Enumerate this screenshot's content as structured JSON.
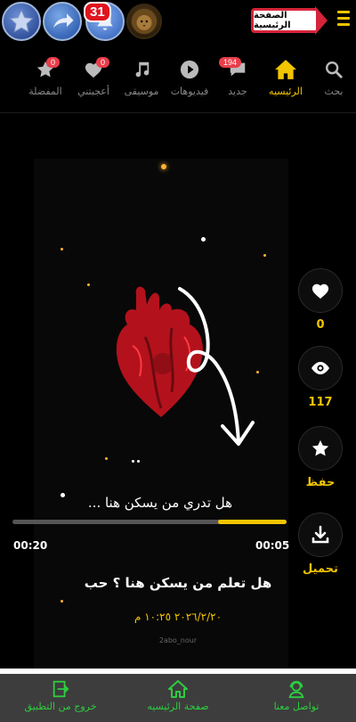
{
  "topbar": {
    "notification_count": "31",
    "home_sign_label": "الصفحة الرئيسية"
  },
  "nav": {
    "items": [
      {
        "label": "بحث",
        "icon": "search-icon"
      },
      {
        "label": "الرئيسيه",
        "icon": "home-icon",
        "active": true
      },
      {
        "label": "جديد",
        "icon": "chat-bubble-icon",
        "badge": "194"
      },
      {
        "label": "فيديوهات",
        "icon": "play-icon"
      },
      {
        "label": "موسيقى",
        "icon": "music-note-icon"
      },
      {
        "label": "أعجبتني",
        "icon": "heart-icon",
        "badge": "0"
      },
      {
        "label": "المفضلة",
        "icon": "star-icon",
        "badge": "0"
      }
    ]
  },
  "video": {
    "caption": "هل تدري من يسكن هنا ...",
    "time_elapsed": "00:05",
    "time_total": "00:20",
    "progress": 0.25
  },
  "post": {
    "title": "هل تعلم من يسكن هنا ؟ حب",
    "date": "٢٠٢٦/٢/٢٠ ١٠:٢٥ م",
    "watermark": "2abo_nour"
  },
  "actions": {
    "likes": "0",
    "views": "117",
    "save_label": "حفظ",
    "download_label": "تحميل"
  },
  "bottombar": {
    "contact_label": "تواصل معنا",
    "home_label": "صفحة الرئيسيه",
    "exit_label": "خروج من التطبيق"
  },
  "colors": {
    "accent": "#f2c500",
    "badge": "#e83e4a",
    "bottom_green": "#2ecc40"
  }
}
